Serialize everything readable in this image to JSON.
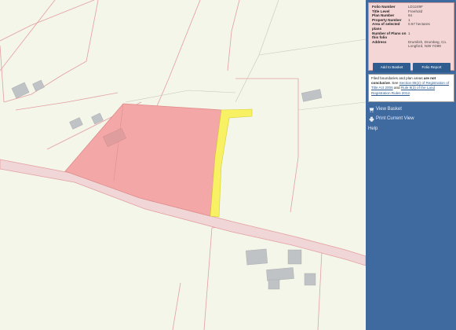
{
  "folio": {
    "rows": [
      {
        "key": "Folio Number",
        "value": "LD1249F"
      },
      {
        "key": "Title Level",
        "value": "Freehold"
      },
      {
        "key": "Plan Number",
        "value": "64"
      },
      {
        "key": "Property Number",
        "value": "1"
      },
      {
        "key": "Area of selected plans",
        "value": "0.67 hectares"
      },
      {
        "key": "Number of Plans on this folio",
        "value": "1"
      },
      {
        "key": "Address",
        "value": "Drumlish, Drumbeg, Co. Longford, N39 YD99"
      }
    ],
    "add_label": "Add to Basket",
    "report_label": "Folio Report"
  },
  "disclaimer": {
    "part1": "Filed boundaries and plan areas ",
    "bold": "are not conclusive",
    "part2": ". See ",
    "link1": "Section 85(2) of Registration of Title Act 2006",
    "part3": " and ",
    "link2": "Rule 9(3) of the Land Registration Rules 2012",
    "part4": "."
  },
  "links": {
    "view_basket": "View Basket",
    "print_view": "Print Current View",
    "help": "Help"
  },
  "colors": {
    "sidebar": "#3f6aa0",
    "selected_plot": "#f3a7a7",
    "adjacent_strip": "#f7f163",
    "road": "#f0d6d6",
    "plot_border": "#e08a8a"
  },
  "icons": {
    "basket": "basket-icon",
    "print": "print-icon"
  }
}
